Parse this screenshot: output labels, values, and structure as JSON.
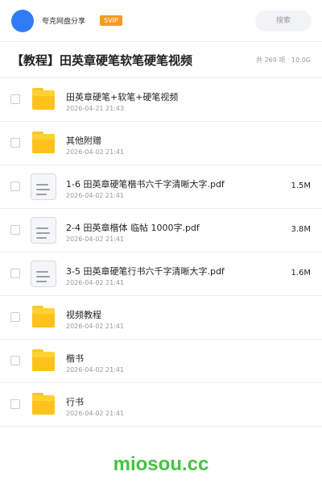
{
  "header": {
    "user_name": "夸克网盘分享",
    "badge": "SVIP",
    "search_placeholder": "搜索",
    "colors": {
      "avatar": "#2f7cf6",
      "badge": "#f59a23"
    }
  },
  "share": {
    "title": "【教程】田英章硬笔软笔硬笔视频",
    "meta": "共 269 项 · 10.0G"
  },
  "files": [
    {
      "type": "folder",
      "icon": "folder-icon",
      "name": "田英章硬笔+软笔+硬笔视频",
      "date": "2026-04-21 21:43",
      "size": ""
    },
    {
      "type": "folder",
      "icon": "folder-icon",
      "name": "其他附赠",
      "date": "2026-04-02 21:41",
      "size": ""
    },
    {
      "type": "file",
      "icon": "document-icon",
      "name": "1-6 田英章硬笔楷书六千字清晰大字.pdf",
      "date": "2026-04-02 21:41",
      "size": "1.5M"
    },
    {
      "type": "file",
      "icon": "document-icon",
      "name": "2-4 田英章楷体 临帖 1000字.pdf",
      "date": "2026-04-02 21:41",
      "size": "3.8M"
    },
    {
      "type": "file",
      "icon": "document-icon",
      "name": "3-5 田英章硬笔行书六千字清晰大字.pdf",
      "date": "2026-04-02 21:41",
      "size": "1.6M"
    },
    {
      "type": "folder",
      "icon": "folder-icon",
      "name": "视频教程",
      "date": "2026-04-02 21:41",
      "size": ""
    },
    {
      "type": "folder",
      "icon": "folder-icon",
      "name": "楷书",
      "date": "2026-04-02 21:41",
      "size": ""
    },
    {
      "type": "folder",
      "icon": "folder-icon",
      "name": "行书",
      "date": "2026-04-02 21:41",
      "size": ""
    }
  ],
  "watermark": "miosou.cc"
}
